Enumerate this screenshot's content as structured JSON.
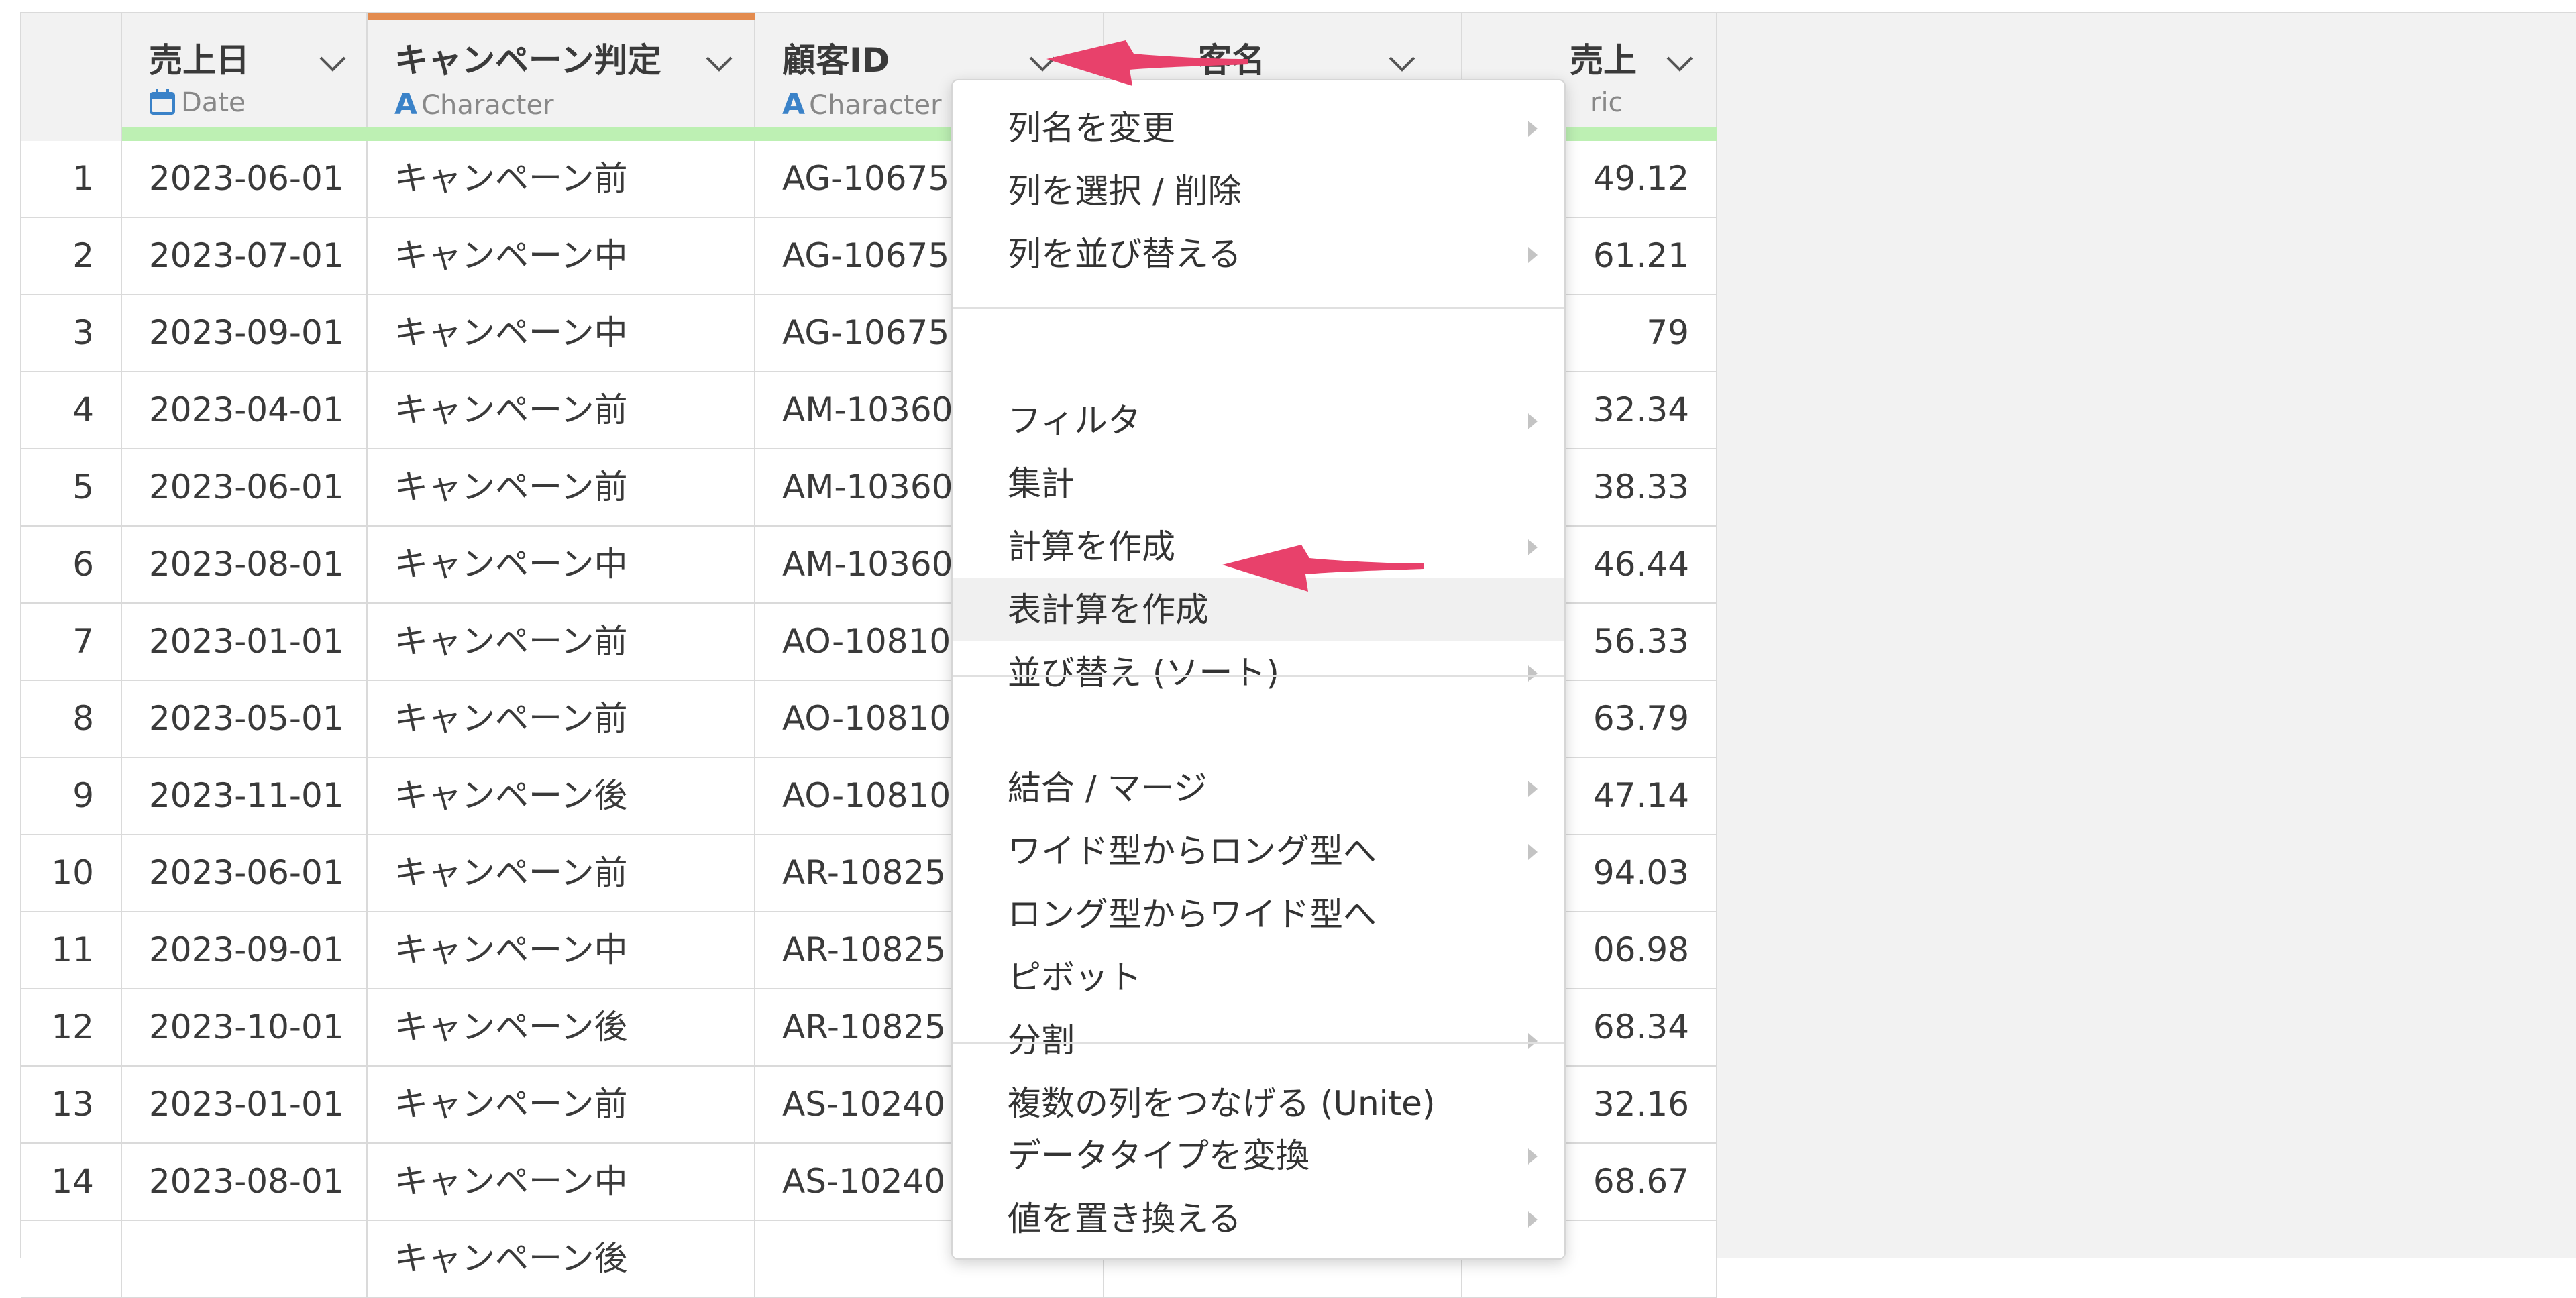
{
  "columns": [
    {
      "name": "売上日",
      "type_label": "Date",
      "type_icon": "calendar-icon"
    },
    {
      "name": "キャンペーン判定",
      "type_label": "Character",
      "type_icon": "character-type-icon"
    },
    {
      "name": "顧客ID",
      "type_label": "Character",
      "type_icon": "character-type-icon"
    },
    {
      "name": "客名",
      "type_label": "",
      "type_icon": "character-type-icon"
    },
    {
      "name": "売上",
      "type_label": "ric",
      "type_icon": "numeric-type-icon"
    }
  ],
  "rows": [
    {
      "num": "1",
      "date": "2023-06-01",
      "campaign": "キャンペーン前",
      "customer_id": "AG-10675",
      "sales": "49.12"
    },
    {
      "num": "2",
      "date": "2023-07-01",
      "campaign": "キャンペーン中",
      "customer_id": "AG-10675",
      "sales": "61.21"
    },
    {
      "num": "3",
      "date": "2023-09-01",
      "campaign": "キャンペーン中",
      "customer_id": "AG-10675",
      "sales": "79"
    },
    {
      "num": "4",
      "date": "2023-04-01",
      "campaign": "キャンペーン前",
      "customer_id": "AM-10360",
      "sales": "32.34"
    },
    {
      "num": "5",
      "date": "2023-06-01",
      "campaign": "キャンペーン前",
      "customer_id": "AM-10360",
      "sales": "38.33"
    },
    {
      "num": "6",
      "date": "2023-08-01",
      "campaign": "キャンペーン中",
      "customer_id": "AM-10360",
      "sales": "46.44"
    },
    {
      "num": "7",
      "date": "2023-01-01",
      "campaign": "キャンペーン前",
      "customer_id": "AO-10810",
      "sales": "56.33"
    },
    {
      "num": "8",
      "date": "2023-05-01",
      "campaign": "キャンペーン前",
      "customer_id": "AO-10810",
      "sales": "63.79"
    },
    {
      "num": "9",
      "date": "2023-11-01",
      "campaign": "キャンペーン後",
      "customer_id": "AO-10810",
      "sales": "47.14"
    },
    {
      "num": "10",
      "date": "2023-06-01",
      "campaign": "キャンペーン前",
      "customer_id": "AR-10825",
      "sales": "94.03"
    },
    {
      "num": "11",
      "date": "2023-09-01",
      "campaign": "キャンペーン中",
      "customer_id": "AR-10825",
      "sales": "06.98"
    },
    {
      "num": "12",
      "date": "2023-10-01",
      "campaign": "キャンペーン後",
      "customer_id": "AR-10825",
      "sales": "68.34"
    },
    {
      "num": "13",
      "date": "2023-01-01",
      "campaign": "キャンペーン前",
      "customer_id": "AS-10240",
      "sales": "32.16"
    },
    {
      "num": "14",
      "date": "2023-08-01",
      "campaign": "キャンペーン中",
      "customer_id": "AS-10240",
      "sales": "68.67"
    }
  ],
  "partial_row": {
    "campaign": "キャンペーン後"
  },
  "menu": {
    "groups": [
      [
        {
          "label": "列名を変更",
          "submenu": true
        },
        {
          "label": "列を選択 / 削除",
          "submenu": false
        },
        {
          "label": "列を並び替える",
          "submenu": true
        }
      ],
      [
        {
          "label": "フィルタ",
          "submenu": true
        },
        {
          "label": "集計",
          "submenu": false
        },
        {
          "label": "計算を作成",
          "submenu": true
        },
        {
          "label": "表計算を作成",
          "submenu": false,
          "highlighted": true
        },
        {
          "label": "並び替え (ソート)",
          "submenu": true
        }
      ],
      [
        {
          "label": "結合 / マージ",
          "submenu": true
        },
        {
          "label": "ワイド型からロング型へ",
          "submenu": true
        },
        {
          "label": "ロング型からワイド型へ",
          "submenu": false
        },
        {
          "label": "ピボット",
          "submenu": false
        },
        {
          "label": "分割",
          "submenu": true
        },
        {
          "label": "複数の列をつなげる (Unite)",
          "submenu": false
        }
      ],
      [
        {
          "label": "データタイプを変換",
          "submenu": true
        },
        {
          "label": "値を置き換える",
          "submenu": true
        }
      ]
    ]
  },
  "colors": {
    "annotation_arrow": "#e8416b",
    "active_column_stripe": "#e38b4e",
    "header_green_bar": "#bdf0b3",
    "type_icon": "#3a82c8"
  }
}
